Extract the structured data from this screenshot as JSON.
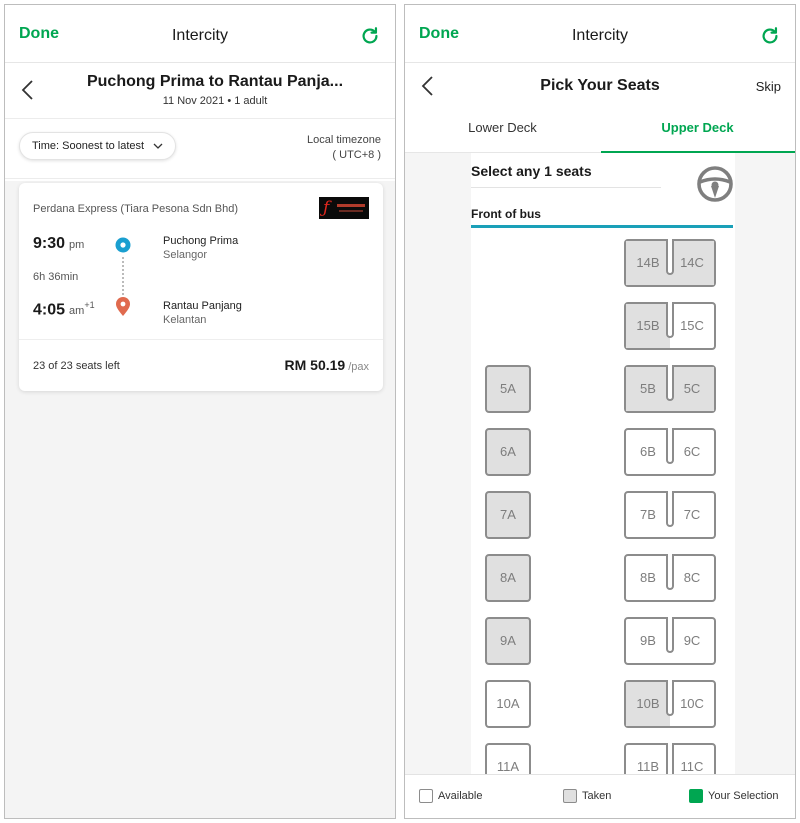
{
  "left": {
    "topbar": {
      "done": "Done",
      "title": "Intercity"
    },
    "route": {
      "title": "Puchong Prima to Rantau Panja...",
      "subtitle": "11 Nov 2021 • 1 adult"
    },
    "filter": {
      "sort_label": "Time: Soonest to latest",
      "tz_line1": "Local timezone",
      "tz_line2": "( UTC+8 )"
    },
    "trip": {
      "operator": "Perdana Express (Tiara Pesona Sdn Bhd)",
      "departure_time": "9:30",
      "departure_period": "pm",
      "duration": "6h 36min",
      "arrival_time": "4:05",
      "arrival_period": "am",
      "arrival_day_offset": "+1",
      "origin_name": "Puchong Prima",
      "origin_state": "Selangor",
      "dest_name": "Rantau Panjang",
      "dest_state": "Kelantan",
      "seats_left": "23 of 23 seats left",
      "price": "RM 50.19",
      "price_unit": "/pax"
    }
  },
  "right": {
    "topbar": {
      "done": "Done",
      "title": "Intercity"
    },
    "header": {
      "title": "Pick Your Seats",
      "skip": "Skip"
    },
    "tabs": {
      "lower": "Lower Deck",
      "upper": "Upper Deck"
    },
    "seatmap": {
      "select_label": "Select any 1 seats",
      "front_label": "Front of bus",
      "singles": [
        {
          "label": "5A",
          "status": "taken"
        },
        {
          "label": "6A",
          "status": "taken"
        },
        {
          "label": "7A",
          "status": "taken"
        },
        {
          "label": "8A",
          "status": "taken"
        },
        {
          "label": "9A",
          "status": "taken"
        },
        {
          "label": "10A",
          "status": "available"
        },
        {
          "label": "11A",
          "status": "available"
        }
      ],
      "pairs": [
        {
          "left": "14B",
          "left_status": "taken",
          "right": "14C",
          "right_status": "taken"
        },
        {
          "left": "15B",
          "left_status": "taken",
          "right": "15C",
          "right_status": "available"
        },
        {
          "left": "5B",
          "left_status": "taken",
          "right": "5C",
          "right_status": "taken"
        },
        {
          "left": "6B",
          "left_status": "available",
          "right": "6C",
          "right_status": "available"
        },
        {
          "left": "7B",
          "left_status": "available",
          "right": "7C",
          "right_status": "available"
        },
        {
          "left": "8B",
          "left_status": "available",
          "right": "8C",
          "right_status": "available"
        },
        {
          "left": "9B",
          "left_status": "available",
          "right": "9C",
          "right_status": "available"
        },
        {
          "left": "10B",
          "left_status": "taken",
          "right": "10C",
          "right_status": "available"
        },
        {
          "left": "11B",
          "left_status": "available",
          "right": "11C",
          "right_status": "available"
        }
      ]
    },
    "legend": {
      "available": "Available",
      "taken": "Taken",
      "selected": "Your Selection"
    }
  },
  "colors": {
    "accent": "#00a651",
    "origin_dot": "#1a9fd0",
    "dest_pin": "#e06a4e",
    "front_bar": "#1aa0b8"
  }
}
